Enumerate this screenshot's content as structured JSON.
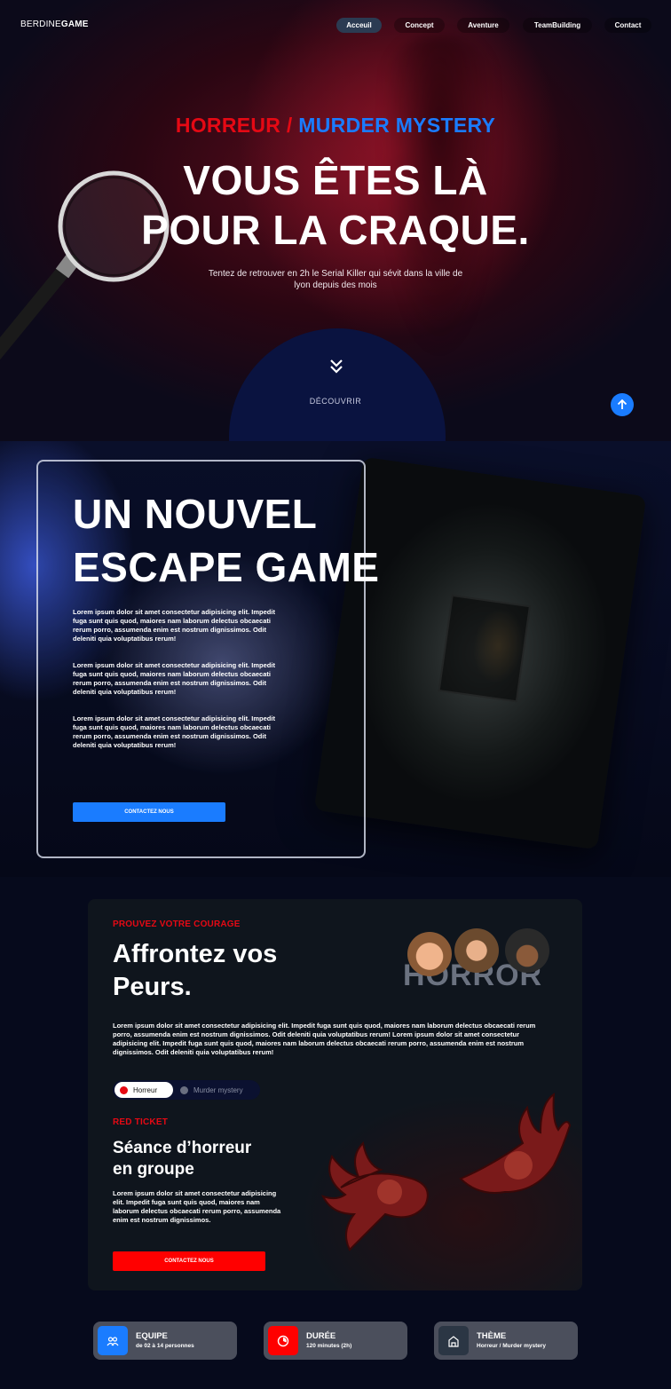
{
  "brand": {
    "logo_light": "BERDINE",
    "logo_bold": "GAME"
  },
  "nav": {
    "items": [
      "Acceuil",
      "Concept",
      "Aventure",
      "TeamBuilding",
      "Contact"
    ]
  },
  "hero": {
    "tagline_red": "HORREUR /",
    "tagline_blue": "MURDER MYSTERY",
    "title_line1": "VOUS ÊTES LÀ",
    "title_line2": "POUR LA CRAQUE.",
    "subtitle": "Tentez de retrouver en 2h le Serial Killer qui sévit dans la ville de lyon depuis des mois",
    "discover_label": "DÉCOUVRIR"
  },
  "escape": {
    "title_line1": "UN NOUVEL",
    "title_line2": "ESCAPE GAME",
    "paragraphs": [
      "Lorem ipsum dolor sit amet consectetur adipisicing elit. Impedit fuga sunt quis quod, maiores nam laborum delectus obcaecati rerum porro, assumenda enim est nostrum dignissimos. Odit deleniti quia voluptatibus rerum!",
      "Lorem ipsum dolor sit amet consectetur adipisicing elit. Impedit fuga sunt quis quod, maiores nam laborum delectus obcaecati rerum porro, assumenda enim est nostrum dignissimos. Odit deleniti quia voluptatibus rerum!",
      "Lorem ipsum dolor sit amet consectetur adipisicing elit. Impedit fuga sunt quis quod, maiores nam laborum delectus obcaecati rerum porro, assumenda enim est nostrum dignissimos. Odit deleniti quia voluptatibus rerum!"
    ],
    "button_label": "CONTACTEZ NOUS"
  },
  "horror_card": {
    "eyebrow": "PROUVEZ VOTRE COURAGE",
    "title_line1": "Affrontez vos",
    "title_line2": "Peurs.",
    "horror_word": "HORROR",
    "paragraph": "Lorem ipsum dolor sit amet consectetur adipisicing elit. Impedit fuga sunt quis quod, maiores nam laborum delectus obcaecati rerum porro, assumenda enim est nostrum dignissimos. Odit deleniti quia voluptatibus rerum! Lorem ipsum dolor sit amet consectetur adipisicing elit. Impedit fuga sunt quis quod, maiores nam laborum delectus obcaecati rerum porro, assumenda enim est nostrum dignissimos. Odit deleniti quia voluptatibus rerum!",
    "toggle": {
      "active": "Horreur",
      "inactive": "Murder mystery"
    },
    "ticket_eyebrow": "RED TICKET",
    "ticket_title_line1": "Séance d’horreur",
    "ticket_title_line2": "en groupe",
    "ticket_paragraph": "Lorem ipsum dolor sit amet consectetur adipisicing elit. Impedit fuga sunt quis quod, maiores nam laborum delectus obcaecati rerum porro, assumenda enim est nostrum dignissimos.",
    "button_label": "CONTACTEZ NOUS"
  },
  "info": [
    {
      "label": "EQUIPE",
      "value": "de 02 à 14 personnes",
      "icon": "team-icon",
      "color": "#1a7cff"
    },
    {
      "label": "DURÉE",
      "value": "120 minutes (2h)",
      "icon": "timer-icon",
      "color": "#ff0000"
    },
    {
      "label": "THÈME",
      "value": "Horreur / Murder mystery",
      "icon": "theme-icon",
      "color": "#2b3644"
    }
  ],
  "colors": {
    "accent_blue": "#1a7cff",
    "accent_red": "#e50914",
    "card_bg": "#0f151d",
    "page_bg": "#060a1c"
  }
}
